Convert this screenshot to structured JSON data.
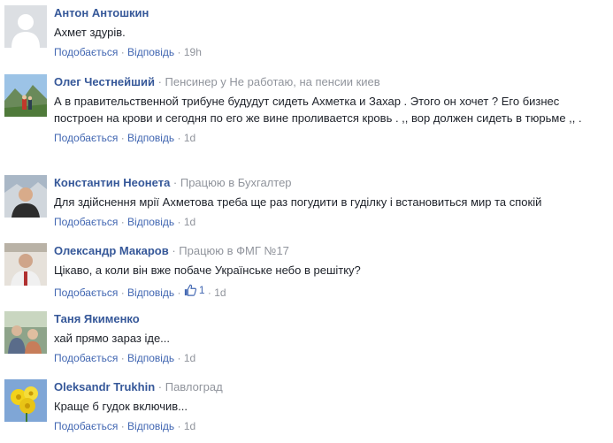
{
  "comments": [
    {
      "author": "Антон Антошкин",
      "job": "",
      "text": "Ахмет здурів.",
      "like_label": "Подобається",
      "reply_label": "Відповідь",
      "time": "19h",
      "likes": ""
    },
    {
      "author": "Олег Честнейший",
      "job": "Пенсинер у Не работаю, на пенсии киев",
      "text": "А в правительственной трибуне будудут сидеть Ахметка и Захар . Этого он хочет ? Его бизнес построен на крови и сегодня по его же вине проливается кровь . ,, вор должен сидеть в тюрьме ,, .",
      "like_label": "Подобається",
      "reply_label": "Відповідь",
      "time": "1d",
      "likes": ""
    },
    {
      "author": "Константин Неонета",
      "job": "Працюю в Бухгалтер",
      "text": "Для здійснення мрії Ахметова треба ще раз погудити в гуділку і встановиться мир та спокій",
      "like_label": "Подобається",
      "reply_label": "Відповідь",
      "time": "1d",
      "likes": ""
    },
    {
      "author": "Олександр Макаров",
      "job": "Працюю в ФМГ №17",
      "text": "Цікаво, а коли він вже побаче Українське небо в решітку?",
      "like_label": "Подобається",
      "reply_label": "Відповідь",
      "time": "1d",
      "likes": "1"
    },
    {
      "author": "Таня Якименко",
      "job": "",
      "text": "хай прямо зараз іде...",
      "like_label": "Подобається",
      "reply_label": "Відповідь",
      "time": "1d",
      "likes": ""
    },
    {
      "author": "Oleksandr Trukhin",
      "job": "Павлоград",
      "text": "Краще б гудок включив...",
      "like_label": "Подобається",
      "reply_label": "Відповідь",
      "time": "1d",
      "likes": ""
    }
  ],
  "separator": " · ",
  "colors": {
    "name": "#365899",
    "link": "#4267b2",
    "meta": "#90949c",
    "text": "#1d2129"
  }
}
